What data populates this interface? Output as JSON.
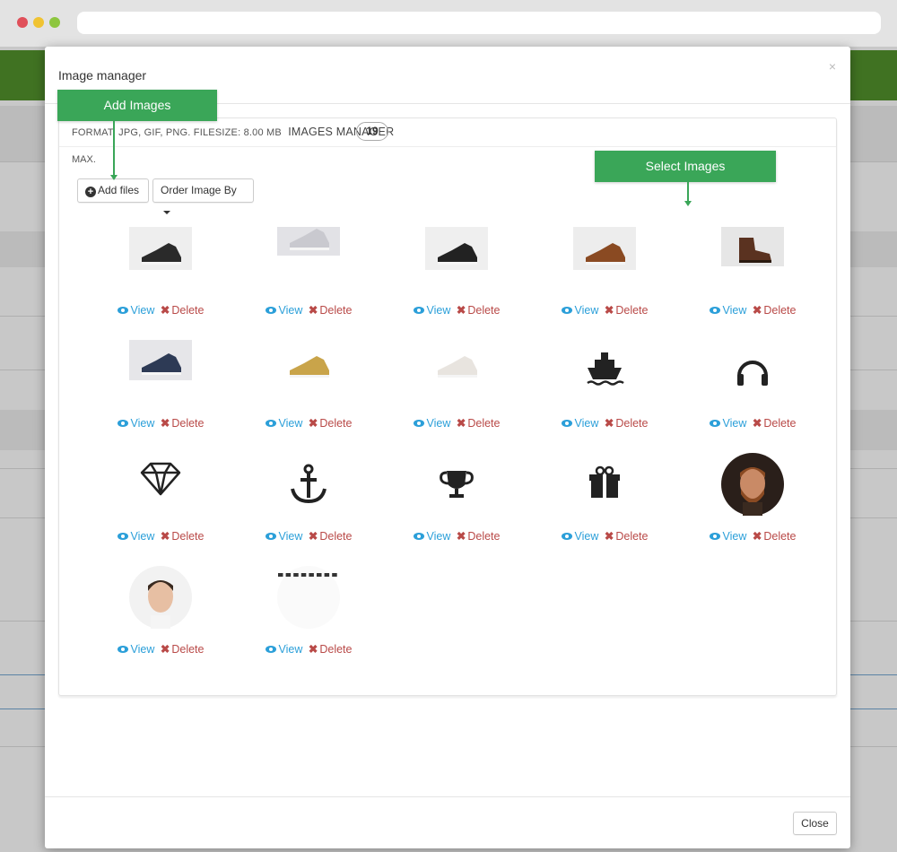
{
  "modal": {
    "title": "Image manager",
    "close_glyph": "×",
    "format_text": "FORMAT: JPG, GIF, PNG. FILESIZE: 8.00 MB",
    "manager_label": "IMAGES MANAGER",
    "image_count": "19",
    "max_text": "MAX.",
    "add_files_label": "Add files",
    "order_label": "Order Image By",
    "close_button_label": "Close"
  },
  "callouts": {
    "add_images": "Add Images",
    "select_images": "Select Images"
  },
  "actions": {
    "view": "View",
    "delete": "Delete"
  },
  "images": [
    {
      "name": "casual-shoes-black-sneaker",
      "icon": "shoe"
    },
    {
      "name": "white-high-top-sneaker",
      "icon": "shoe"
    },
    {
      "name": "casual-shoes-black-high-top",
      "icon": "shoe"
    },
    {
      "name": "brown-leather-shoe",
      "icon": "shoe"
    },
    {
      "name": "brown-leather-boot",
      "icon": "boot"
    },
    {
      "name": "navy-canvas-sneaker",
      "icon": "shoe"
    },
    {
      "name": "gold-high-top-sneaker",
      "icon": "shoe"
    },
    {
      "name": "white-sole-sneaker",
      "icon": "shoe"
    },
    {
      "name": "ship-icon",
      "icon": "ship"
    },
    {
      "name": "headphones-icon",
      "icon": "headphones"
    },
    {
      "name": "diamond-icon",
      "icon": "diamond"
    },
    {
      "name": "anchor-icon",
      "icon": "anchor"
    },
    {
      "name": "trophy-icon",
      "icon": "trophy"
    },
    {
      "name": "gift-icon",
      "icon": "gift"
    },
    {
      "name": "bearded-man-portrait",
      "icon": "avatar"
    },
    {
      "name": "young-man-portrait",
      "icon": "avatar"
    },
    {
      "name": "dots-strip-image",
      "icon": "dots"
    }
  ]
}
